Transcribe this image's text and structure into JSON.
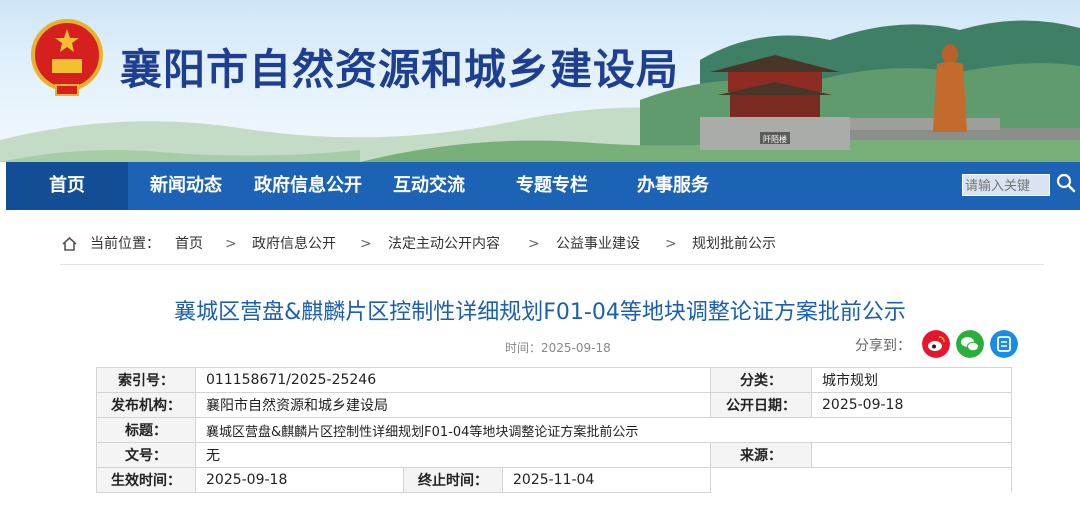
{
  "header": {
    "site_title": "襄阳市自然资源和城乡建设局",
    "gate_sign": "阡陌楼"
  },
  "nav": {
    "items": [
      "首页",
      "新闻动态",
      "政府信息公开",
      "互动交流",
      "专题专栏",
      "办事服务"
    ],
    "active": "首页"
  },
  "search": {
    "placeholder": "请输入关键"
  },
  "breadcrumb": {
    "prefix": "当前位置：",
    "items": [
      "首页",
      "政府信息公开",
      "法定主动公开内容",
      "公益事业建设",
      "规划批前公示"
    ],
    "separator": ">"
  },
  "article": {
    "title": "襄城区营盘&麒麟片区控制性详细规划F01-04等地块调整论证方案批前公示",
    "date_label": "时间：",
    "date": "2025-09-18",
    "share_label": "分享到："
  },
  "share": {
    "icons": [
      "weibo-icon",
      "wechat-icon",
      "qzone-icon"
    ],
    "colors": [
      "#e6162d",
      "#2aae3c",
      "#1a8be6"
    ]
  },
  "info_table": {
    "index_label": "索引号：",
    "index_value": "011158671/2025-25246",
    "category_label": "分类：",
    "category_value": "城市规划",
    "publisher_label": "发布机构：",
    "publisher_value": "襄阳市自然资源和城乡建设局",
    "pubdate_label": "公开日期：",
    "pubdate_value": "2025-09-18",
    "title_label": "标题：",
    "title_value": "襄城区营盘&麒麟片区控制性详细规划F01-04等地块调整论证方案批前公示",
    "docno_label": "文号：",
    "docno_value": "无",
    "source_label": "来源：",
    "source_value": "",
    "effective_label": "生效时间：",
    "effective_value": "2025-09-18",
    "end_label": "终止时间：",
    "end_value": "2025-11-04"
  },
  "colors": {
    "nav_bg": "#1c62b5",
    "nav_active": "#124d96",
    "title_blue": "#1b5fb4",
    "site_title": "#1e3f8f"
  }
}
